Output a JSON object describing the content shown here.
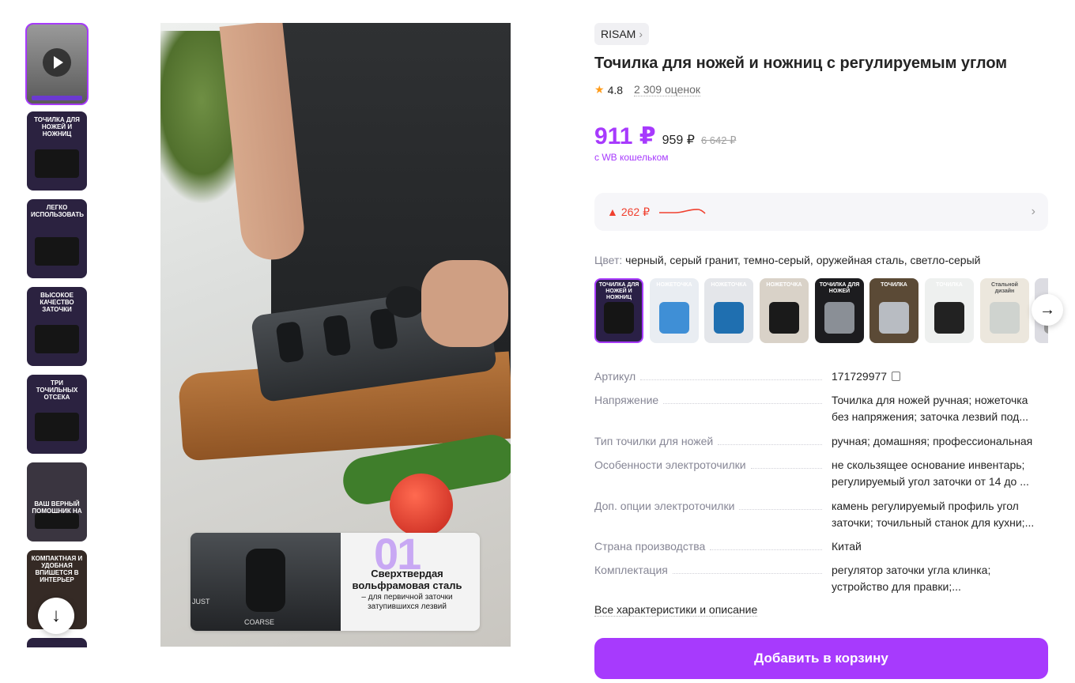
{
  "brand": {
    "name": "RISAM"
  },
  "product": {
    "title": "Точилка для ножей и ножниц с регулируемым углом",
    "rating": "4.8",
    "reviews": "2 309 оценок"
  },
  "price": {
    "current": "911 ₽",
    "regular": "959 ₽",
    "old": "6 642 ₽",
    "wallet_note": "с WB кошельком"
  },
  "price_history": {
    "delta": "262 ₽"
  },
  "colors": {
    "label": "Цвет:",
    "value": "черный, серый гранит, темно-серый, оружейная сталь, светло-серый",
    "swatches": [
      {
        "caption": "ТОЧИЛКА ДЛЯ НОЖЕЙ И НОЖНИЦ",
        "bg": "#2a2046",
        "obj": "#151515"
      },
      {
        "caption": "НОЖЕТОЧКА",
        "bg": "#e9edf2",
        "obj": "#3f8fd6"
      },
      {
        "caption": "НОЖЕТОЧКА",
        "bg": "#e4e6ea",
        "obj": "#1f6fb0"
      },
      {
        "caption": "НОЖЕТОЧКА",
        "bg": "#d9d2c8",
        "obj": "#1a1a1a"
      },
      {
        "caption": "ТОЧИЛКА ДЛЯ НОЖЕЙ",
        "bg": "#1c1c1f",
        "obj": "#8a8f96"
      },
      {
        "caption": "ТОЧИЛКА",
        "bg": "#5b4a36",
        "obj": "#b8bcc2"
      },
      {
        "caption": "ТОЧИЛКА",
        "bg": "#eef0ef",
        "obj": "#222"
      },
      {
        "caption": "Стальной дизайн",
        "bg": "#ece7dd",
        "obj": "#cfd3cf"
      },
      {
        "caption": "",
        "bg": "#dcdce2",
        "obj": "#999"
      }
    ]
  },
  "specs": [
    {
      "key": "Артикул",
      "value": "171729977"
    },
    {
      "key": "Напряжение",
      "value": "Точилка для ножей ручная; ножеточка без напряжения; заточка лезвий под..."
    },
    {
      "key": "Тип точилки для ножей",
      "value": "ручная; домашняя; профессиональная"
    },
    {
      "key": "Особенности электроточилки",
      "value": "не скользящее основание инвентарь; регулируемый угол заточки от 14 до ..."
    },
    {
      "key": "Доп. опции электроточилки",
      "value": "камень регулируемый профиль угол заточки; точильный станок для кухни;..."
    },
    {
      "key": "Страна производства",
      "value": "Китай"
    },
    {
      "key": "Комплектация",
      "value": "регулятор заточки угла клинка; устройство для правки;..."
    }
  ],
  "links": {
    "all_specs": "Все характеристики и описание"
  },
  "actions": {
    "add_to_cart": "Добавить в корзину"
  },
  "gallery": {
    "thumbs": [
      {
        "caption": "",
        "video": true
      },
      {
        "caption": "ТОЧИЛКА ДЛЯ НОЖЕЙ И НОЖНИЦ"
      },
      {
        "caption": "ЛЕГКО ИСПОЛЬЗОВАТЬ"
      },
      {
        "caption": "ВЫСОКОЕ КАЧЕСТВО ЗАТОЧКИ"
      },
      {
        "caption": "ТРИ ТОЧИЛЬНЫХ ОТСЕКА"
      },
      {
        "caption": "ВАШ ВЕРНЫЙ ПОМОЩНИК НА КУХНЕ"
      },
      {
        "caption": "КОМПАКТНАЯ И УДОБНАЯ ВПИШЕТСЯ В ИНТЕРЬЕР"
      }
    ],
    "inset": {
      "number": "01",
      "headline": "Сверхтвердая вольфрамовая сталь",
      "subline": "– для первичной заточки затупившихся лезвий",
      "label_just": "JUST",
      "label_coarse": "COARSE"
    }
  },
  "colors_theme": {
    "accent": "#a73afd",
    "price_up": "#f0402f"
  }
}
